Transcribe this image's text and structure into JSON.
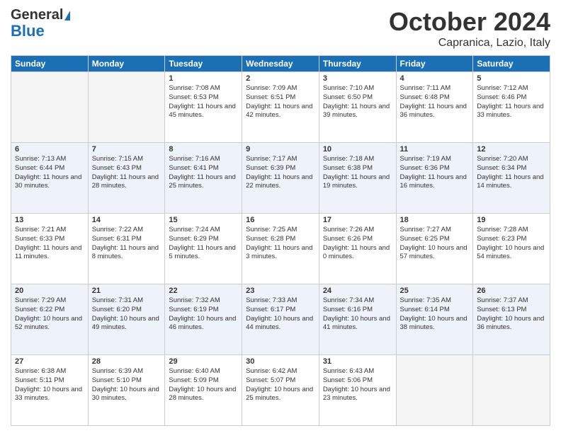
{
  "logo": {
    "line1": "General",
    "line2": "Blue"
  },
  "header": {
    "month": "October 2024",
    "location": "Capranica, Lazio, Italy"
  },
  "days_of_week": [
    "Sunday",
    "Monday",
    "Tuesday",
    "Wednesday",
    "Thursday",
    "Friday",
    "Saturday"
  ],
  "weeks": [
    [
      {
        "day": "",
        "info": ""
      },
      {
        "day": "",
        "info": ""
      },
      {
        "day": "1",
        "sunrise": "Sunrise: 7:08 AM",
        "sunset": "Sunset: 6:53 PM",
        "daylight": "Daylight: 11 hours and 45 minutes."
      },
      {
        "day": "2",
        "sunrise": "Sunrise: 7:09 AM",
        "sunset": "Sunset: 6:51 PM",
        "daylight": "Daylight: 11 hours and 42 minutes."
      },
      {
        "day": "3",
        "sunrise": "Sunrise: 7:10 AM",
        "sunset": "Sunset: 6:50 PM",
        "daylight": "Daylight: 11 hours and 39 minutes."
      },
      {
        "day": "4",
        "sunrise": "Sunrise: 7:11 AM",
        "sunset": "Sunset: 6:48 PM",
        "daylight": "Daylight: 11 hours and 36 minutes."
      },
      {
        "day": "5",
        "sunrise": "Sunrise: 7:12 AM",
        "sunset": "Sunset: 6:46 PM",
        "daylight": "Daylight: 11 hours and 33 minutes."
      }
    ],
    [
      {
        "day": "6",
        "sunrise": "Sunrise: 7:13 AM",
        "sunset": "Sunset: 6:44 PM",
        "daylight": "Daylight: 11 hours and 30 minutes."
      },
      {
        "day": "7",
        "sunrise": "Sunrise: 7:15 AM",
        "sunset": "Sunset: 6:43 PM",
        "daylight": "Daylight: 11 hours and 28 minutes."
      },
      {
        "day": "8",
        "sunrise": "Sunrise: 7:16 AM",
        "sunset": "Sunset: 6:41 PM",
        "daylight": "Daylight: 11 hours and 25 minutes."
      },
      {
        "day": "9",
        "sunrise": "Sunrise: 7:17 AM",
        "sunset": "Sunset: 6:39 PM",
        "daylight": "Daylight: 11 hours and 22 minutes."
      },
      {
        "day": "10",
        "sunrise": "Sunrise: 7:18 AM",
        "sunset": "Sunset: 6:38 PM",
        "daylight": "Daylight: 11 hours and 19 minutes."
      },
      {
        "day": "11",
        "sunrise": "Sunrise: 7:19 AM",
        "sunset": "Sunset: 6:36 PM",
        "daylight": "Daylight: 11 hours and 16 minutes."
      },
      {
        "day": "12",
        "sunrise": "Sunrise: 7:20 AM",
        "sunset": "Sunset: 6:34 PM",
        "daylight": "Daylight: 11 hours and 14 minutes."
      }
    ],
    [
      {
        "day": "13",
        "sunrise": "Sunrise: 7:21 AM",
        "sunset": "Sunset: 6:33 PM",
        "daylight": "Daylight: 11 hours and 11 minutes."
      },
      {
        "day": "14",
        "sunrise": "Sunrise: 7:22 AM",
        "sunset": "Sunset: 6:31 PM",
        "daylight": "Daylight: 11 hours and 8 minutes."
      },
      {
        "day": "15",
        "sunrise": "Sunrise: 7:24 AM",
        "sunset": "Sunset: 6:29 PM",
        "daylight": "Daylight: 11 hours and 5 minutes."
      },
      {
        "day": "16",
        "sunrise": "Sunrise: 7:25 AM",
        "sunset": "Sunset: 6:28 PM",
        "daylight": "Daylight: 11 hours and 3 minutes."
      },
      {
        "day": "17",
        "sunrise": "Sunrise: 7:26 AM",
        "sunset": "Sunset: 6:26 PM",
        "daylight": "Daylight: 11 hours and 0 minutes."
      },
      {
        "day": "18",
        "sunrise": "Sunrise: 7:27 AM",
        "sunset": "Sunset: 6:25 PM",
        "daylight": "Daylight: 10 hours and 57 minutes."
      },
      {
        "day": "19",
        "sunrise": "Sunrise: 7:28 AM",
        "sunset": "Sunset: 6:23 PM",
        "daylight": "Daylight: 10 hours and 54 minutes."
      }
    ],
    [
      {
        "day": "20",
        "sunrise": "Sunrise: 7:29 AM",
        "sunset": "Sunset: 6:22 PM",
        "daylight": "Daylight: 10 hours and 52 minutes."
      },
      {
        "day": "21",
        "sunrise": "Sunrise: 7:31 AM",
        "sunset": "Sunset: 6:20 PM",
        "daylight": "Daylight: 10 hours and 49 minutes."
      },
      {
        "day": "22",
        "sunrise": "Sunrise: 7:32 AM",
        "sunset": "Sunset: 6:19 PM",
        "daylight": "Daylight: 10 hours and 46 minutes."
      },
      {
        "day": "23",
        "sunrise": "Sunrise: 7:33 AM",
        "sunset": "Sunset: 6:17 PM",
        "daylight": "Daylight: 10 hours and 44 minutes."
      },
      {
        "day": "24",
        "sunrise": "Sunrise: 7:34 AM",
        "sunset": "Sunset: 6:16 PM",
        "daylight": "Daylight: 10 hours and 41 minutes."
      },
      {
        "day": "25",
        "sunrise": "Sunrise: 7:35 AM",
        "sunset": "Sunset: 6:14 PM",
        "daylight": "Daylight: 10 hours and 38 minutes."
      },
      {
        "day": "26",
        "sunrise": "Sunrise: 7:37 AM",
        "sunset": "Sunset: 6:13 PM",
        "daylight": "Daylight: 10 hours and 36 minutes."
      }
    ],
    [
      {
        "day": "27",
        "sunrise": "Sunrise: 6:38 AM",
        "sunset": "Sunset: 5:11 PM",
        "daylight": "Daylight: 10 hours and 33 minutes."
      },
      {
        "day": "28",
        "sunrise": "Sunrise: 6:39 AM",
        "sunset": "Sunset: 5:10 PM",
        "daylight": "Daylight: 10 hours and 30 minutes."
      },
      {
        "day": "29",
        "sunrise": "Sunrise: 6:40 AM",
        "sunset": "Sunset: 5:09 PM",
        "daylight": "Daylight: 10 hours and 28 minutes."
      },
      {
        "day": "30",
        "sunrise": "Sunrise: 6:42 AM",
        "sunset": "Sunset: 5:07 PM",
        "daylight": "Daylight: 10 hours and 25 minutes."
      },
      {
        "day": "31",
        "sunrise": "Sunrise: 6:43 AM",
        "sunset": "Sunset: 5:06 PM",
        "daylight": "Daylight: 10 hours and 23 minutes."
      },
      {
        "day": "",
        "info": ""
      },
      {
        "day": "",
        "info": ""
      }
    ]
  ]
}
